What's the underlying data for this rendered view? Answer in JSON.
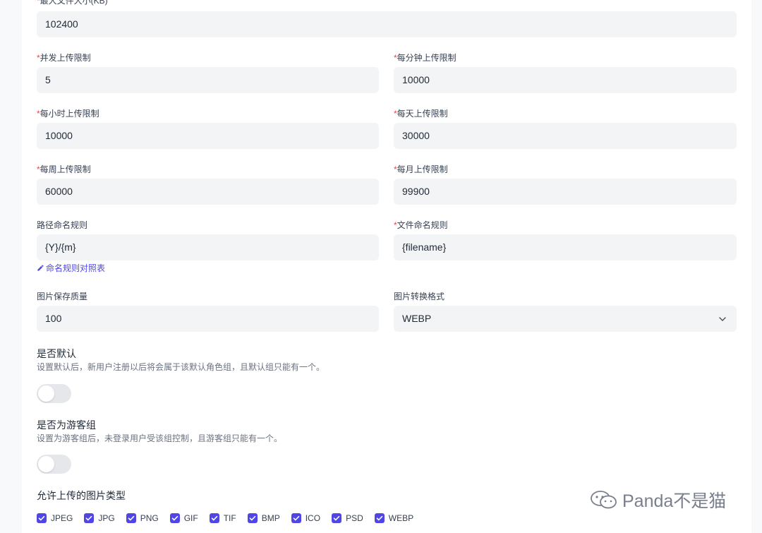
{
  "form": {
    "max_file_size": {
      "required": "*",
      "label": "最大文件大小(KB)",
      "value": "102400"
    },
    "concurrent_limit": {
      "required": "*",
      "label": "并发上传限制",
      "value": "5"
    },
    "per_minute_limit": {
      "required": "*",
      "label": "每分钟上传限制",
      "value": "10000"
    },
    "per_hour_limit": {
      "required": "*",
      "label": "每小时上传限制",
      "value": "10000"
    },
    "per_day_limit": {
      "required": "*",
      "label": "每天上传限制",
      "value": "30000"
    },
    "per_week_limit": {
      "required": "*",
      "label": "每周上传限制",
      "value": "60000"
    },
    "per_month_limit": {
      "required": "*",
      "label": "每月上传限制",
      "value": "99900"
    },
    "path_rule": {
      "label": "路径命名规则",
      "value": "{Y}/{m}"
    },
    "file_rule": {
      "required": "*",
      "label": "文件命名规则",
      "value": "{filename}"
    },
    "naming_table_link": "命名规则对照表",
    "image_quality": {
      "label": "图片保存质量",
      "value": "100"
    },
    "convert_format": {
      "label": "图片转换格式",
      "value": "WEBP"
    }
  },
  "default_group": {
    "title": "是否默认",
    "desc": "设置默认后，新用户注册以后将会属于该默认角色组，且默认组只能有一个。",
    "enabled": false
  },
  "guest_group": {
    "title": "是否为游客组",
    "desc": "设置为游客组后，未登录用户受该组控制，且游客组只能有一个。",
    "enabled": false
  },
  "allowed_types": {
    "title": "允许上传的图片类型",
    "items": [
      {
        "label": "JPEG",
        "checked": true
      },
      {
        "label": "JPG",
        "checked": true
      },
      {
        "label": "PNG",
        "checked": true
      },
      {
        "label": "GIF",
        "checked": true
      },
      {
        "label": "TIF",
        "checked": true
      },
      {
        "label": "BMP",
        "checked": true
      },
      {
        "label": "ICO",
        "checked": true
      },
      {
        "label": "PSD",
        "checked": true
      },
      {
        "label": "WEBP",
        "checked": true
      }
    ]
  },
  "watermark": {
    "text": "Panda不是猫",
    "icon": "wechat-icon"
  },
  "colors": {
    "accent": "#4f46e5",
    "required": "#ef4444",
    "field_bg": "#f3f4f6",
    "toggle_off": "#e5e7eb"
  }
}
